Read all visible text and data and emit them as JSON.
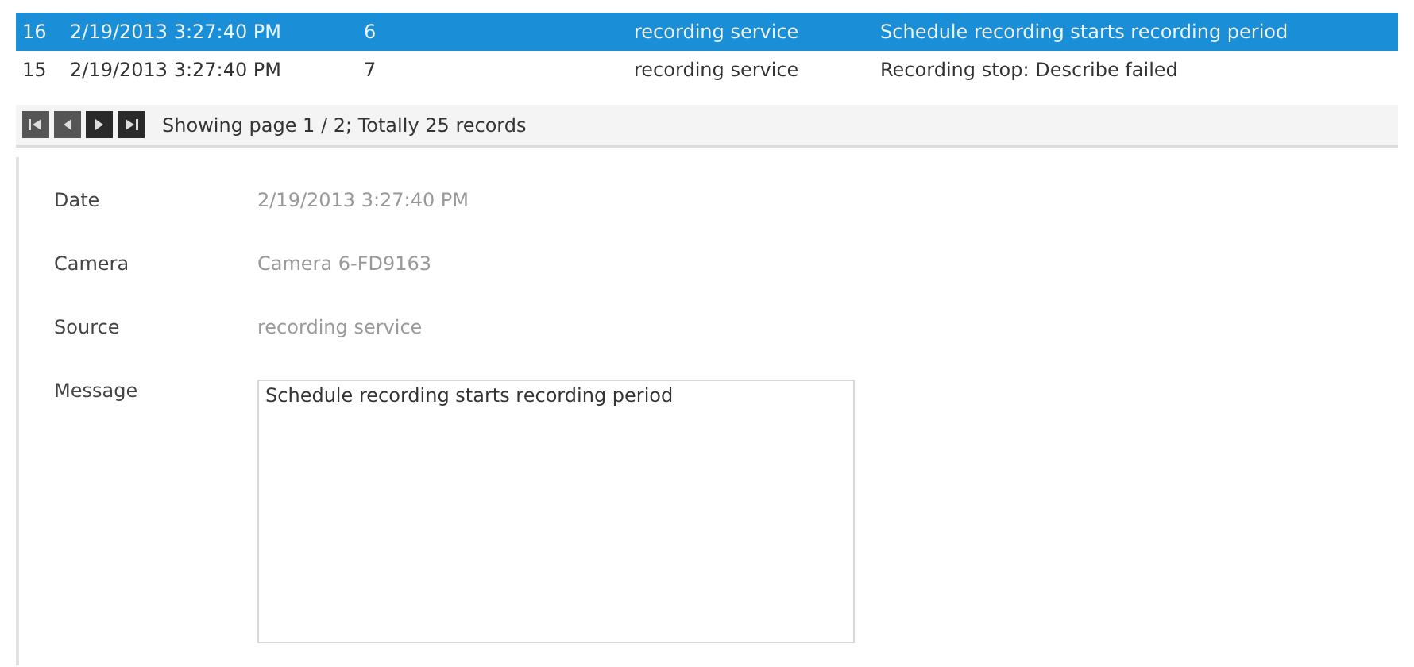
{
  "table": {
    "rows": [
      {
        "id": "16",
        "date": "2/19/2013 3:27:40 PM",
        "level": "6",
        "source": "recording service",
        "message": "Schedule recording starts recording period",
        "selected": true
      },
      {
        "id": "15",
        "date": "2/19/2013 3:27:40 PM",
        "level": "7",
        "source": "recording service",
        "message": "Recording stop: Describe failed",
        "selected": false
      }
    ]
  },
  "pager": {
    "buttons": [
      {
        "kind": "first",
        "disabled": true
      },
      {
        "kind": "prev",
        "disabled": true
      },
      {
        "kind": "next",
        "disabled": false
      },
      {
        "kind": "last",
        "disabled": false
      }
    ],
    "status": "Showing page 1 / 2; Totally 25 records"
  },
  "details": {
    "fields": [
      {
        "label": "Date",
        "value": "2/19/2013 3:27:40 PM"
      },
      {
        "label": "Camera",
        "value": "Camera 6-FD9163"
      },
      {
        "label": "Source",
        "value": "recording service"
      }
    ],
    "message": {
      "label": "Message",
      "value": "Schedule recording starts recording period"
    }
  }
}
